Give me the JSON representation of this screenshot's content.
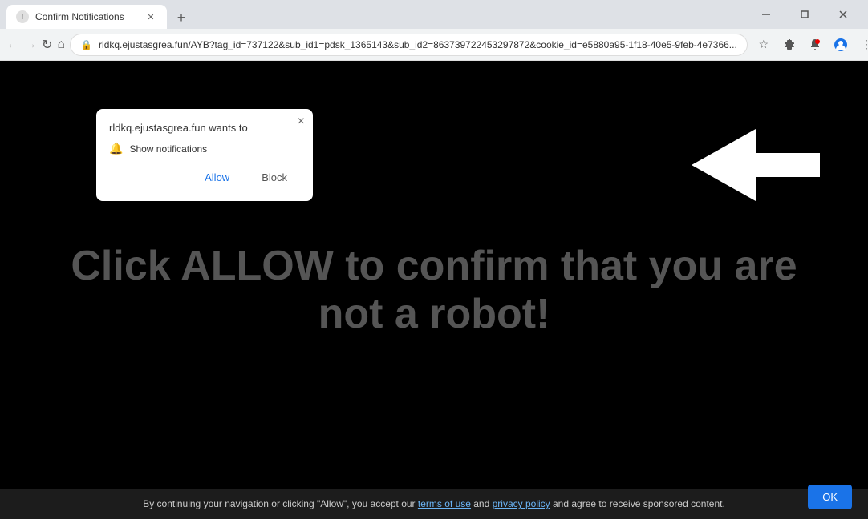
{
  "browser": {
    "tab": {
      "title": "Confirm Notifications",
      "favicon_label": "favicon"
    },
    "new_tab_label": "+",
    "window_controls": {
      "minimize": "−",
      "maximize": "❐",
      "close": "✕"
    },
    "nav": {
      "back": "←",
      "forward": "→",
      "refresh": "↺",
      "home": "⌂"
    },
    "url": "rldkq.ejustasgrea.fun/AYB?tag_id=737122&sub_id1=pdsk_1365143&sub_id2=863739722453297872&cookie_id=e5880a95-1f18-40e5-9feb-4e7366...",
    "addr_icons": {
      "star": "☆",
      "extensions": "🧩",
      "alert": "🔔",
      "account": "👤",
      "menu": "⋮"
    }
  },
  "popup": {
    "title": "rldkq.ejustasgrea.fun wants to",
    "close_label": "×",
    "notification_icon": "🔔",
    "notification_text": "Show notifications",
    "allow_label": "Allow",
    "block_label": "Block"
  },
  "page": {
    "main_text": "Click ALLOW to confirm that you are not a robot!",
    "background_color": "#000000"
  },
  "footer": {
    "text_before_terms": "By continuing your navigation or clicking \"Allow\", you accept our ",
    "terms_label": "terms of use",
    "terms_url": "#",
    "text_between": " and ",
    "privacy_label": "privacy policy",
    "privacy_url": "#",
    "text_after": " and agree to receive sponsored content.",
    "ok_label": "OK"
  }
}
